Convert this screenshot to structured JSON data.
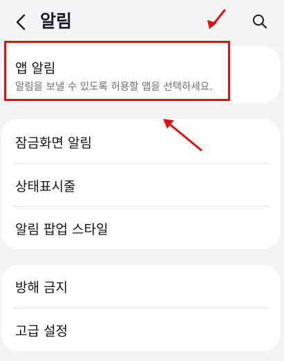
{
  "header": {
    "title": "알림",
    "back_icon": "chevron-left-icon",
    "search_icon": "search-icon"
  },
  "app_notifications": {
    "label": "앱 알림",
    "description": "알림을 보낼 수 있도록 허용할 앱을 선택하세요."
  },
  "settings_group_1": [
    {
      "label": "잠금화면 알림"
    },
    {
      "label": "상태표시줄"
    },
    {
      "label": "알림 팝업 스타일"
    }
  ],
  "settings_group_2": [
    {
      "label": "방해 금지"
    },
    {
      "label": "고급 설정"
    }
  ],
  "annotation_colors": {
    "highlight": "#e01010",
    "arrow": "#e01010"
  }
}
